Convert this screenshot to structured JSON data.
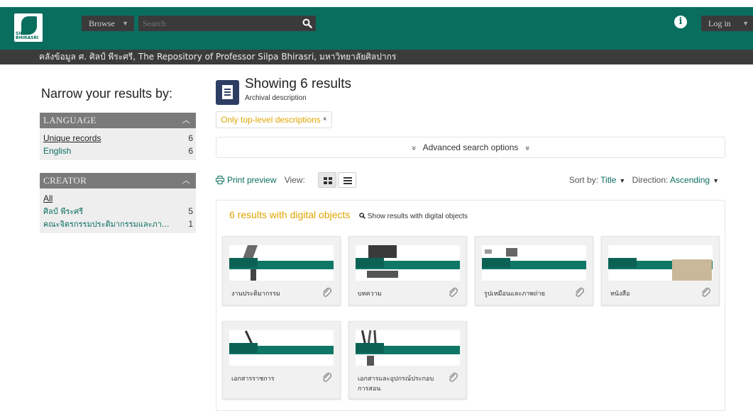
{
  "header": {
    "logo_text": "SILPA BHIRASRI",
    "browse_label": "Browse",
    "search_placeholder": "Search",
    "login_label": "Log in",
    "colors": {
      "brand": "#0a6e5f",
      "dark": "#3b3b3b",
      "accent": "#e0a400"
    }
  },
  "repository": {
    "name": "คลังข้อมูล ศ. ศิลป์ พีระศรี, The Repository of Professor Silpa Bhirasri, มหาวิทยาลัยศิลปากร"
  },
  "sidebar": {
    "title": "Narrow your results by:",
    "facets": [
      {
        "header": "LANGUAGE",
        "rows": [
          {
            "label": "Unique records",
            "count": "6"
          },
          {
            "label": "English",
            "count": "6"
          }
        ]
      },
      {
        "header": "CREATOR",
        "rows": [
          {
            "label": "All",
            "count": ""
          },
          {
            "label": "ศิลป์ พีระศรี",
            "count": "5"
          },
          {
            "label": "คณะจิตรกรรมประติมากรรมและภา...",
            "count": "1"
          }
        ]
      }
    ]
  },
  "main": {
    "title": "Showing 6 results",
    "subtitle": "Archival description",
    "filter_tag": "Only top-level descriptions",
    "filter_remove": "×",
    "advanced_label": "Advanced search options",
    "advanced_chevron": "»",
    "print_label": "Print preview",
    "view_label": "View:",
    "sort": {
      "sort_by_label": "Sort by:",
      "sort_by_value": "Title",
      "direction_label": "Direction:",
      "direction_value": "Ascending"
    },
    "digital": {
      "count_label": "6 results with digital objects",
      "show_label": "Show results with digital objects"
    },
    "cards": [
      {
        "caption": "งานประติมากรรม",
        "icon": "sculpture-thumbnail"
      },
      {
        "caption": "บทความ",
        "icon": "typewriter-thumbnail"
      },
      {
        "caption": "รูปเหมือนและภาพถ่าย",
        "icon": "camera-thumbnail"
      },
      {
        "caption": "หนังสือ",
        "icon": "book-thumbnail"
      },
      {
        "caption": "เอกสารราชการ",
        "icon": "document-thumbnail"
      },
      {
        "caption": "เอกสารและอุปกรณ์ประกอบการสอน",
        "icon": "brushes-thumbnail"
      }
    ]
  }
}
